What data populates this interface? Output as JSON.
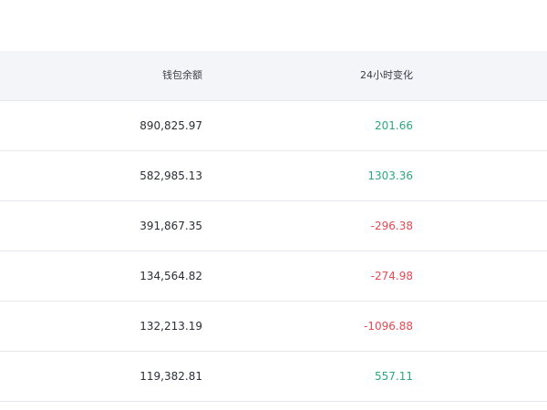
{
  "table": {
    "columns": {
      "balance": "钱包余额",
      "change_24h": "24小时变化"
    },
    "rows": [
      {
        "balance": "890,825.97",
        "change": "201.66",
        "direction": "up"
      },
      {
        "balance": "582,985.13",
        "change": "1303.36",
        "direction": "up"
      },
      {
        "balance": "391,867.35",
        "change": "-296.38",
        "direction": "down"
      },
      {
        "balance": "134,564.82",
        "change": "-274.98",
        "direction": "down"
      },
      {
        "balance": "132,213.19",
        "change": "-1096.88",
        "direction": "down"
      },
      {
        "balance": "119,382.81",
        "change": "557.11",
        "direction": "up"
      }
    ]
  },
  "colors": {
    "positive": "#2ea77d",
    "negative": "#e24a55",
    "header_bg": "#f4f5f9",
    "divider": "#e6e8ee"
  }
}
